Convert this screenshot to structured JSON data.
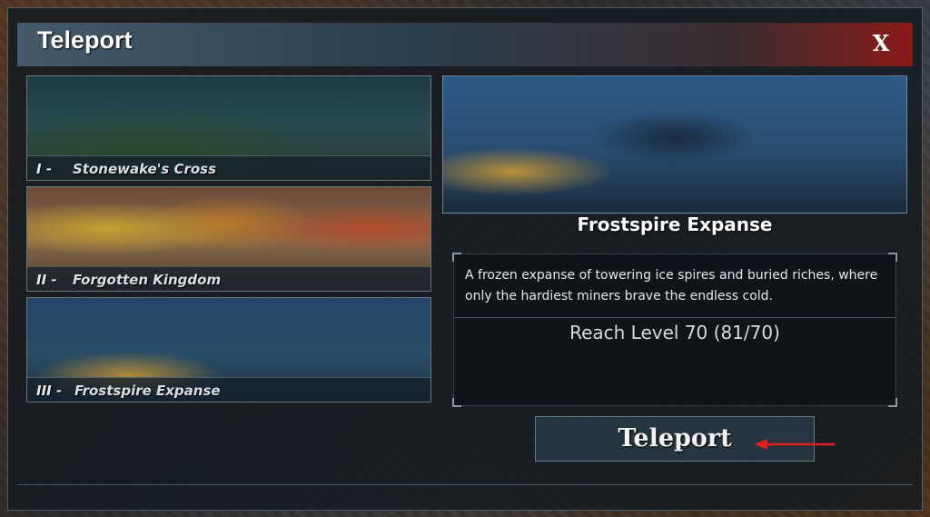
{
  "window": {
    "title": "Teleport",
    "close_label": "X"
  },
  "locations": [
    {
      "numeral": "I",
      "separator": "-",
      "name": "Stonewake's Cross"
    },
    {
      "numeral": "II",
      "separator": "-",
      "name": "Forgotten Kingdom"
    },
    {
      "numeral": "III",
      "separator": "-",
      "name": "Frostspire Expanse"
    }
  ],
  "selected": {
    "name": "Frostspire Expanse",
    "description": "A frozen expanse of towering ice spires and buried riches, where only the hardiest miners brave the endless cold.",
    "requirement": "Reach Level 70 (81/70)"
  },
  "actions": {
    "teleport_label": "Teleport"
  },
  "colors": {
    "accent_red": "#8a1a18",
    "arrow": "#e02020"
  },
  "icons": [
    "close-icon",
    "red-arrow-icon"
  ]
}
